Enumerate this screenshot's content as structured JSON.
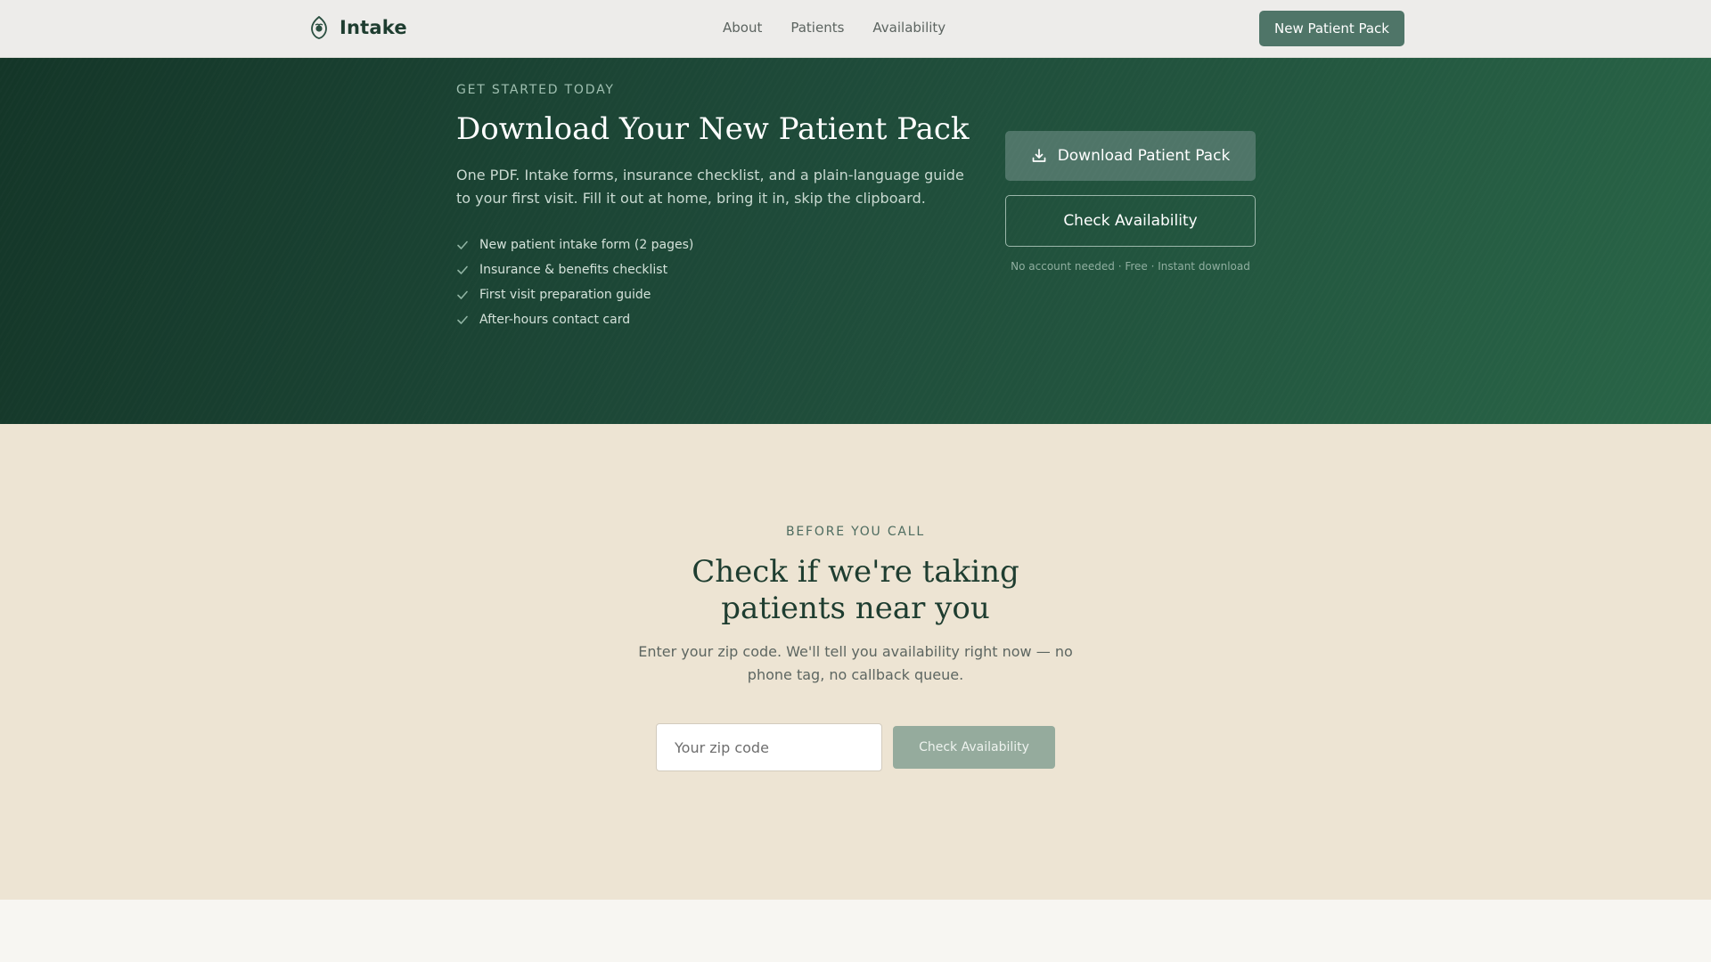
{
  "header": {
    "brand": "Intake",
    "nav": [
      "About",
      "Patients",
      "Availability"
    ],
    "cta": "New Patient Pack"
  },
  "hero": {
    "eyebrow": "GET STARTED TODAY",
    "title": "Download Your New Patient Pack",
    "description": "One PDF. Intake forms, insurance checklist, and a plain-language guide to your first visit. Fill it out at home, bring it in, skip the clipboard.",
    "checklist": [
      "New patient intake form (2 pages)",
      "Insurance & benefits checklist",
      "First visit preparation guide",
      "After-hours contact card"
    ],
    "download_label": "Download Patient Pack",
    "check_label": "Check Availability",
    "note": "No account needed · Free · Instant download"
  },
  "availability": {
    "eyebrow": "BEFORE YOU CALL",
    "title": "Check if we're taking patients near you",
    "description": "Enter your zip code. We'll tell you availability right now — no phone tag, no callback queue.",
    "zip_placeholder": "Your zip code",
    "button_label": "Check Availability"
  },
  "colors": {
    "brand_dark": "#1e3d30",
    "accent": "#4f7568",
    "hero_bg_start": "#143628",
    "hero_bg_end": "#296547",
    "section_bg": "#ede4d3",
    "disabled_button": "#95ab9d"
  },
  "icons": {
    "brand": "leaf-shield-icon",
    "checklist": "checkmark-icon",
    "download": "download-icon"
  }
}
